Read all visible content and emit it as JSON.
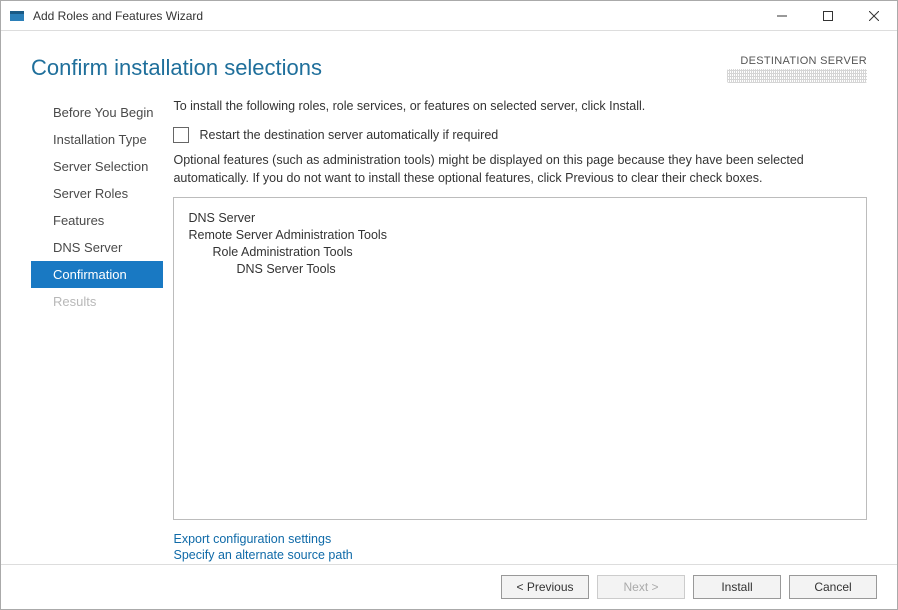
{
  "window": {
    "title": "Add Roles and Features Wizard"
  },
  "header": {
    "page_title": "Confirm installation selections",
    "destination_label": "DESTINATION SERVER"
  },
  "sidebar": {
    "items": [
      {
        "label": "Before You Begin",
        "active": false,
        "disabled": false
      },
      {
        "label": "Installation Type",
        "active": false,
        "disabled": false
      },
      {
        "label": "Server Selection",
        "active": false,
        "disabled": false
      },
      {
        "label": "Server Roles",
        "active": false,
        "disabled": false
      },
      {
        "label": "Features",
        "active": false,
        "disabled": false
      },
      {
        "label": "DNS Server",
        "active": false,
        "disabled": false
      },
      {
        "label": "Confirmation",
        "active": true,
        "disabled": false
      },
      {
        "label": "Results",
        "active": false,
        "disabled": true
      }
    ]
  },
  "content": {
    "intro": "To install the following roles, role services, or features on selected server, click Install.",
    "restart_label": "Restart the destination server automatically if required",
    "restart_checked": false,
    "note": "Optional features (such as administration tools) might be displayed on this page because they have been selected automatically. If you do not want to install these optional features, click Previous to clear their check boxes.",
    "features": [
      {
        "text": "DNS Server",
        "level": 1
      },
      {
        "text": "Remote Server Administration Tools",
        "level": 1
      },
      {
        "text": "Role Administration Tools",
        "level": 2
      },
      {
        "text": "DNS Server Tools",
        "level": 3
      }
    ],
    "links": {
      "export": "Export configuration settings",
      "alt_source": "Specify an alternate source path"
    }
  },
  "buttons": {
    "previous": "< Previous",
    "next": "Next >",
    "install": "Install",
    "cancel": "Cancel",
    "next_disabled": true
  }
}
